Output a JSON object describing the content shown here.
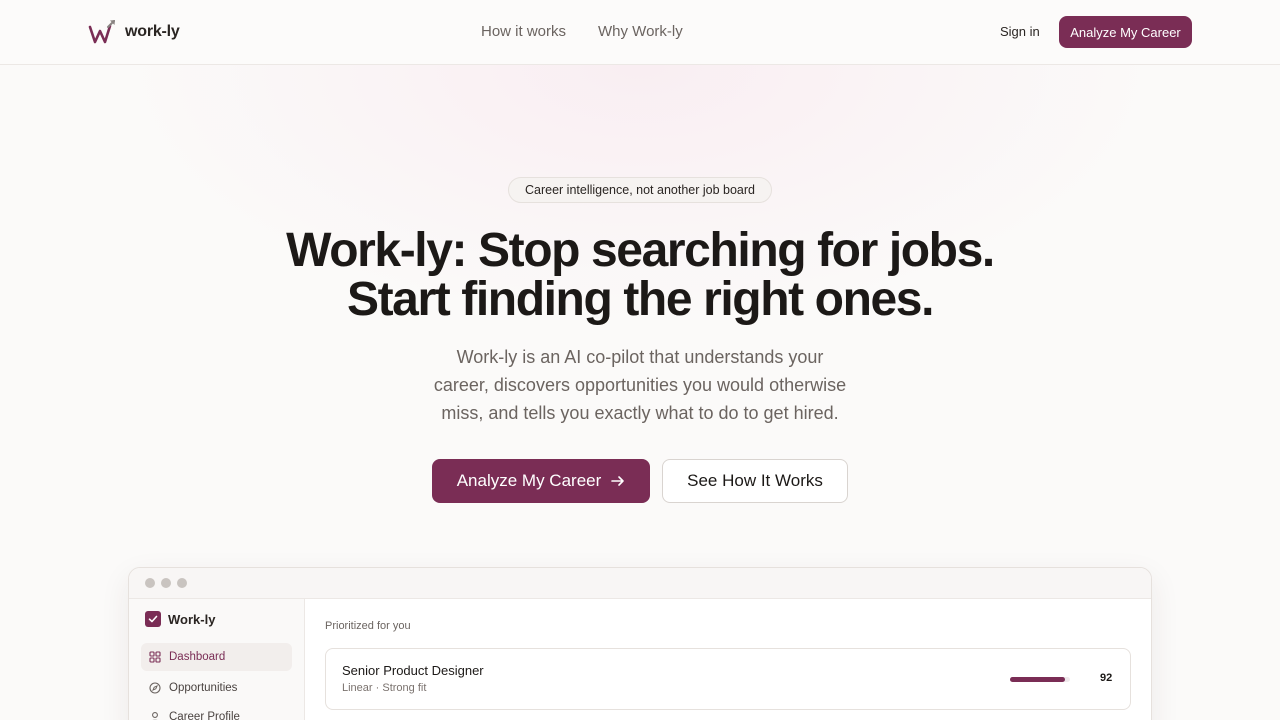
{
  "header": {
    "brand": "work-ly",
    "nav": [
      "How it works",
      "Why Work-ly"
    ],
    "signin_label": "Sign in",
    "cta_label": "Analyze My Career"
  },
  "hero": {
    "badge": "Career intelligence, not another job board",
    "title_lines": [
      "Work-ly: Stop searching for jobs.",
      "Start finding the right ones."
    ],
    "subtitle_lines": [
      "Work-ly is an AI co-pilot that understands your",
      "career, discovers opportunities you would otherwise",
      "miss, and tells you exactly what to do to get hired."
    ],
    "primary_cta": "Analyze My Career",
    "secondary_cta": "See How It Works"
  },
  "preview": {
    "sidebar": {
      "brand": "Work-ly",
      "items": [
        {
          "label": "Dashboard",
          "icon": "grid-icon",
          "active": true
        },
        {
          "label": "Opportunities",
          "icon": "compass-icon",
          "active": false
        },
        {
          "label": "Career Profile",
          "icon": "user-icon",
          "active": false
        }
      ]
    },
    "section_title": "Prioritized for you",
    "jobs": [
      {
        "title": "Senior Product Designer",
        "meta": "Linear · Strong fit",
        "score": 92
      }
    ]
  },
  "colors": {
    "accent": "#7a2d55",
    "text": "#1c1917",
    "muted": "#6b6460",
    "background": "#fbfaf9"
  }
}
